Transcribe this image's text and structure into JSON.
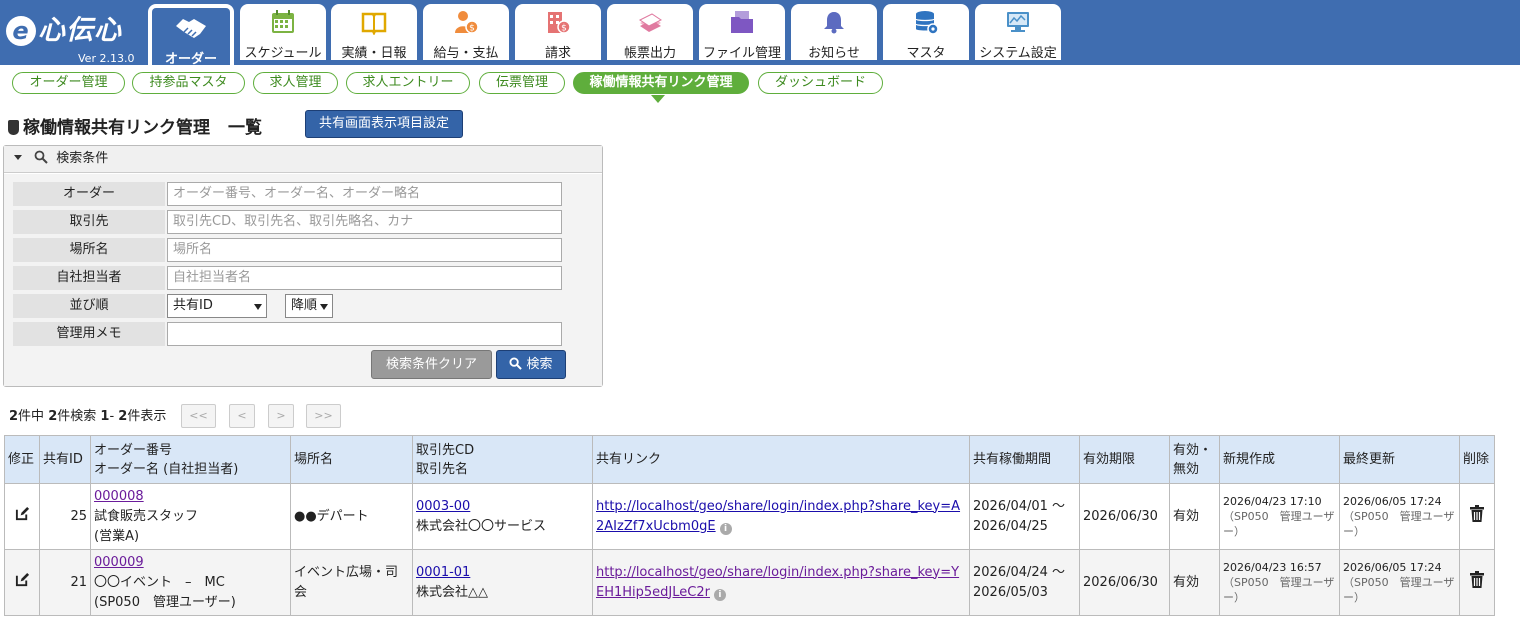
{
  "app": {
    "logo_text": "心伝心",
    "logo_e": "e",
    "version": "Ver 2.13.0"
  },
  "tabs": [
    {
      "label": "オーダー",
      "icon": "handshake-icon",
      "active": true
    },
    {
      "label": "スケジュール",
      "icon": "calendar-icon"
    },
    {
      "label": "実績・日報",
      "icon": "book-icon"
    },
    {
      "label": "給与・支払",
      "icon": "person-money-icon"
    },
    {
      "label": "請求",
      "icon": "building-money-icon"
    },
    {
      "label": "帳票出力",
      "icon": "papers-icon"
    },
    {
      "label": "ファイル管理",
      "icon": "folder-icon"
    },
    {
      "label": "お知らせ",
      "icon": "bell-icon"
    },
    {
      "label": "マスタ",
      "icon": "database-icon"
    },
    {
      "label": "システム設定",
      "icon": "monitor-settings-icon"
    }
  ],
  "subnav": [
    {
      "label": "オーダー管理"
    },
    {
      "label": "持参品マスタ"
    },
    {
      "label": "求人管理"
    },
    {
      "label": "求人エントリー"
    },
    {
      "label": "伝票管理"
    },
    {
      "label": "稼働情報共有リンク管理",
      "active": true
    },
    {
      "label": "ダッシュボード"
    }
  ],
  "page": {
    "title": "稼働情報共有リンク管理",
    "title_suffix": "一覧",
    "settings_button": "共有画面表示項目設定"
  },
  "search": {
    "header": "検索条件",
    "fields": [
      {
        "label": "オーダー",
        "placeholder": "オーダー番号、オーダー名、オーダー略名"
      },
      {
        "label": "取引先",
        "placeholder": "取引先CD、取引先名、取引先略名、カナ"
      },
      {
        "label": "場所名",
        "placeholder": "場所名"
      },
      {
        "label": "自社担当者",
        "placeholder": "自社担当者名"
      }
    ],
    "sort_label": "並び順",
    "sort_field": "共有ID",
    "sort_order": "降順",
    "memo_label": "管理用メモ",
    "memo_value": "",
    "clear_button": "検索条件クリア",
    "search_button": "検索"
  },
  "pager": {
    "total": "2",
    "found": "2",
    "from": "1",
    "to": "2",
    "t1": "件中",
    "t2": "件検索",
    "t3": "-",
    "t4": "件表示",
    "first": "<<",
    "prev": "<",
    "next": ">",
    "last": ">>"
  },
  "table": {
    "headers": {
      "edit": "修正",
      "share_id": "共有ID",
      "order_no": "オーダー番号",
      "order_name": "オーダー名 (自社担当者)",
      "place": "場所名",
      "client_cd": "取引先CD",
      "client_name": "取引先名",
      "link": "共有リンク",
      "period": "共有稼働期間",
      "expiry": "有効期限",
      "valid1": "有効・",
      "valid2": "無効",
      "created": "新規作成",
      "updated": "最終更新",
      "delete": "削除"
    },
    "rows": [
      {
        "share_id": "25",
        "order_no": "000008",
        "order_name": "試食販売スタッフ",
        "order_staff": "(営業A)",
        "place": "●●デパート",
        "client_cd": "0003-00",
        "client_name": "株式会社〇〇サービス",
        "link": "http://localhost/geo/share/login/index.php?share_key=A2AIzZf7xUcbm0gE",
        "period_from": "2026/04/01 ～",
        "period_to": "2026/04/25",
        "expiry": "2026/06/30",
        "valid": "有効",
        "created_at": "2026/04/23 17:10",
        "created_by": "（SP050　管理ユーザー）",
        "updated_at": "2026/06/05 17:24",
        "updated_by": "（SP050　管理ユーザー）"
      },
      {
        "share_id": "21",
        "order_no": "000009",
        "order_name": "〇〇イベント　–　MC",
        "order_staff": "(SP050　管理ユーザー)",
        "place": "イベント広場・司会",
        "client_cd": "0001-01",
        "client_name": "株式会社△△",
        "link": "http://localhost/geo/share/login/index.php?share_key=YEH1Hip5edJLeC2r",
        "period_from": "2026/04/24 ～",
        "period_to": "2026/05/03",
        "expiry": "2026/06/30",
        "valid": "有効",
        "created_at": "2026/04/23 16:57",
        "created_by": "（SP050　管理ユーザー）",
        "updated_at": "2026/06/05 17:24",
        "updated_by": "（SP050　管理ユーザー）"
      }
    ]
  },
  "colors": {
    "header_blue": "#3f6db0",
    "nav_green": "#5fae3c",
    "table_header": "#d9e7f7"
  }
}
